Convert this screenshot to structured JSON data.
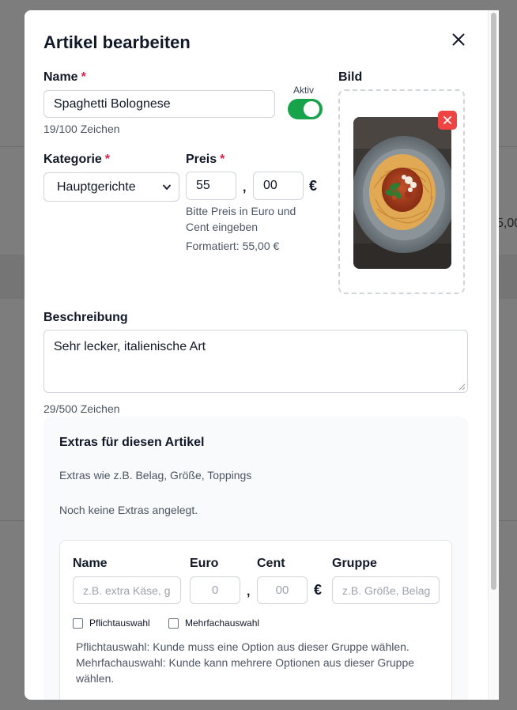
{
  "background": {
    "price_fragment": "5,00"
  },
  "modal": {
    "title": "Artikel bearbeiten",
    "name": {
      "label": "Name",
      "required_mark": "*",
      "value": "Spaghetti Bolognese",
      "counter": "19/100 Zeichen"
    },
    "active": {
      "label": "Aktiv",
      "on": true,
      "color": "#16a34a"
    },
    "image": {
      "label": "Bild"
    },
    "category": {
      "label": "Kategorie",
      "required_mark": "*",
      "selected": "Hauptgerichte"
    },
    "price": {
      "label": "Preis",
      "required_mark": "*",
      "euros": "55",
      "separator": ",",
      "cents": "00",
      "currency": "€",
      "hint": "Bitte Preis in Euro und Cent eingeben",
      "formatted": "Formatiert: 55,00 €"
    },
    "description": {
      "label": "Beschreibung",
      "value": "Sehr lecker, italienische Art",
      "counter": "29/500 Zeichen"
    },
    "extras": {
      "title": "Extras für diesen Artikel",
      "subtitle": "Extras wie z.B. Belag, Größe, Toppings",
      "empty_text": "Noch keine Extras angelegt.",
      "form": {
        "name_label": "Name",
        "name_placeholder": "z.B. extra Käse, g",
        "euro_label": "Euro",
        "euro_placeholder": "0",
        "separator": ",",
        "cent_label": "Cent",
        "cent_placeholder": "00",
        "currency": "€",
        "group_label": "Gruppe",
        "group_placeholder": "z.B. Größe, Belag",
        "required_choice": "Pflichtauswahl",
        "multi_choice": "Mehrfachauswahl",
        "hint": "Pflichtauswahl: Kunde muss eine Option aus dieser Gruppe wählen. Mehrfachauswahl: Kunde kann mehrere Optionen aus dieser Gruppe wählen."
      }
    }
  }
}
